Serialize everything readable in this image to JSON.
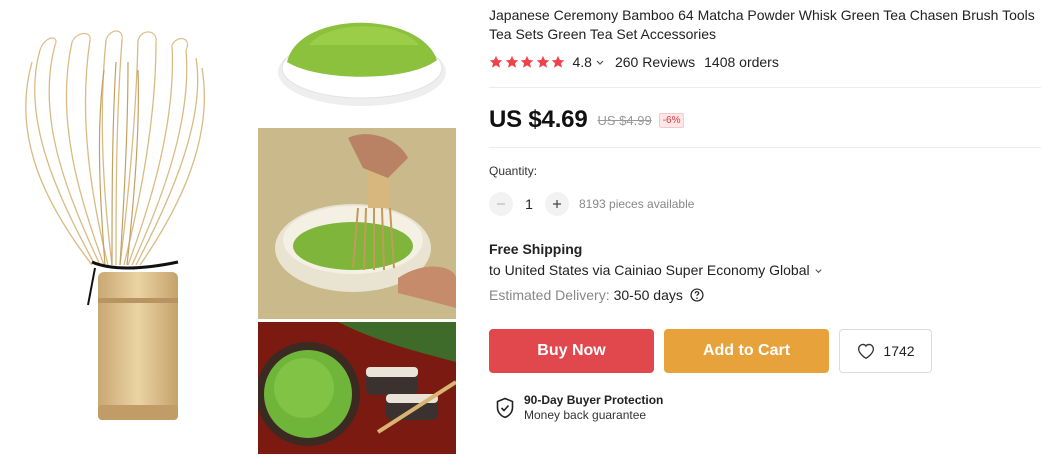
{
  "gallery": {
    "main_image": "bamboo-matcha-whisk-image",
    "thumbnails": [
      "matcha-powder-bowl-image",
      "whisking-matcha-in-bowl-image",
      "matcha-cup-with-sweets-image"
    ]
  },
  "product": {
    "title": "Japanese Ceremony Bamboo 64 Matcha Powder Whisk Green Tea Chasen Brush Tools Tea Sets Green Tea Set Accessories",
    "rating": "4.8",
    "stars": 5,
    "reviews": "260 Reviews",
    "orders": "1408 orders"
  },
  "price": {
    "current": "US $4.69",
    "original": "US $4.99",
    "discount": "-6%"
  },
  "quantity": {
    "label": "Quantity:",
    "value": "1",
    "available": "8193 pieces available"
  },
  "shipping": {
    "title": "Free Shipping",
    "line": "to United States via Cainiao Super Economy Global",
    "delivery_label": "Estimated Delivery:",
    "delivery_value": "30-50 days"
  },
  "actions": {
    "buy_now": "Buy Now",
    "add_to_cart": "Add to Cart",
    "wishlist_count": "1742"
  },
  "protection": {
    "title": "90-Day Buyer Protection",
    "subtitle": "Money back guarantee"
  },
  "colors": {
    "buy_now": "#e0484e",
    "add_to_cart": "#e8a23c",
    "star": "#f0424b",
    "discount_text": "#e0383e"
  }
}
